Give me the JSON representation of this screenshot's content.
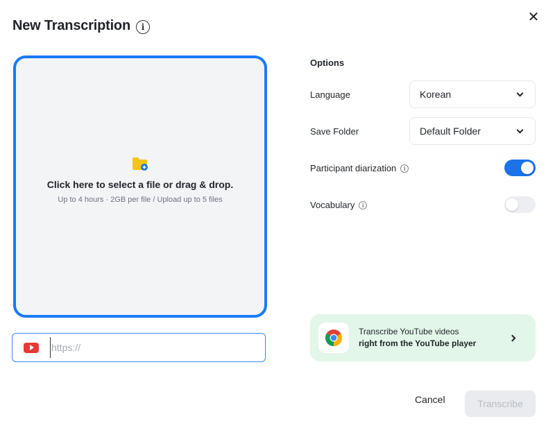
{
  "header": {
    "title": "New Transcription",
    "info_glyph": "i",
    "close_glyph": "✕"
  },
  "dropzone": {
    "main_text": "Click here to select a file or drag & drop.",
    "sub_text": "Up to 4 hours · 2GB per file / Upload up to 5 files",
    "icon": "folder-add-icon",
    "accent": "#1a7af8"
  },
  "url": {
    "placeholder": "https://",
    "value": "",
    "icon": "youtube-icon"
  },
  "options": {
    "heading": "Options",
    "language": {
      "label": "Language",
      "value": "Korean"
    },
    "save_folder": {
      "label": "Save Folder",
      "value": "Default Folder"
    },
    "diarization": {
      "label": "Participant diarization",
      "enabled": true
    },
    "vocabulary": {
      "label": "Vocabulary",
      "enabled": false
    }
  },
  "promo": {
    "line1": "Transcribe YouTube videos",
    "line2": "right from the YouTube player",
    "icon": "chrome-icon"
  },
  "footer": {
    "cancel_label": "Cancel",
    "transcribe_label": "Transcribe",
    "transcribe_disabled": true
  },
  "colors": {
    "primary": "#1a73e8",
    "promo_bg": "#e2f6ea",
    "youtube": "#e53935"
  }
}
